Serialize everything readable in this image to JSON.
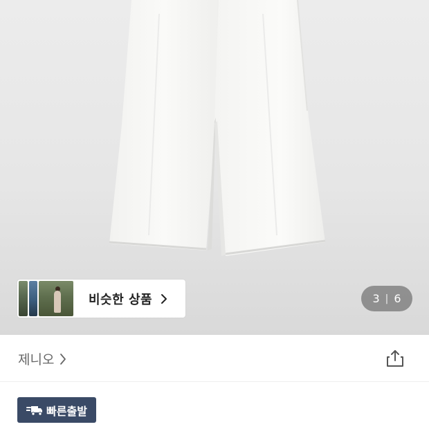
{
  "product_image": {
    "subject": "white wide-leg trousers"
  },
  "similar_products": {
    "label": "비슷한 상품",
    "chevron_icon": "chevron-right-icon"
  },
  "pager": {
    "current": "3",
    "separator": "|",
    "total": "6"
  },
  "brand": {
    "name": "제니오",
    "chevron_icon": "chevron-right-icon",
    "share_icon": "share-icon"
  },
  "delivery_badge": {
    "label": "빠른출발",
    "icon": "truck-icon",
    "color": "#3a4a66"
  },
  "colors": {
    "background": "#ffffff",
    "text_primary": "#222222",
    "text_secondary": "#666666"
  }
}
